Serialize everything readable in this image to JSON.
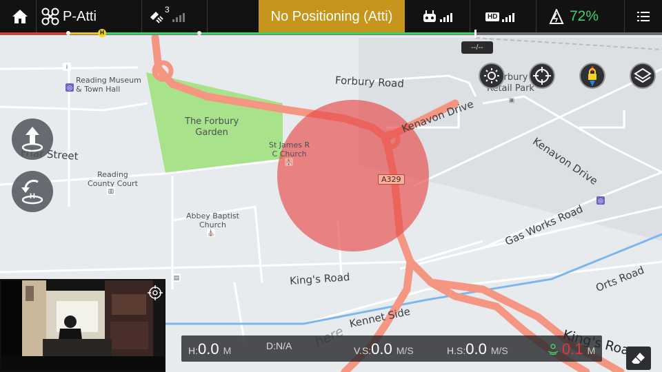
{
  "topbar": {
    "home_icon": "home-icon",
    "mode_label": "P-Atti",
    "satellite_count": "3",
    "status_text": "No Positioning (Atti)",
    "hd_label": "HD",
    "battery_percent": "72%",
    "colors": {
      "status_bg": "#c8951c",
      "battery_green": "#3bd16b"
    }
  },
  "flight_progress": {
    "home_marker": "H",
    "distance": "--/--"
  },
  "map": {
    "labels": {
      "forbury_road": "Forbury Road",
      "kenavon_drive_1": "Kenavon Drive",
      "kenavon_drive_2": "Kenavon Drive",
      "forbury_retail_park": "Forbury\nRetail Park",
      "reading_museum": "Reading Museum\n& Town Hall",
      "forbury_garden": "The Forbury\nGarden",
      "st_james": "St James R\nC Church",
      "friar_street": "Friar Street",
      "reading_county_court": "Reading\nCounty Court",
      "abbey_baptist": "Abbey Baptist\nChurch",
      "a329": "A329",
      "gas_works_road": "Gas Works Road",
      "orts_road": "Orts Road",
      "kings_road_1": "King's Road",
      "kings_road_2": "King's Road",
      "kennet_side": "Kennet Side",
      "watermark": "here"
    }
  },
  "telemetry": {
    "h_label": "H:",
    "h_value": "0.0",
    "h_unit": "M",
    "d_label": "D:",
    "d_value": "N/A",
    "vs_label": "V.S:",
    "vs_value": "0.0",
    "vs_unit": "M/S",
    "hs_label": "H.S:",
    "hs_value": "0.0",
    "hs_unit": "M/S",
    "vps_value": "0.1",
    "vps_unit": "M"
  }
}
